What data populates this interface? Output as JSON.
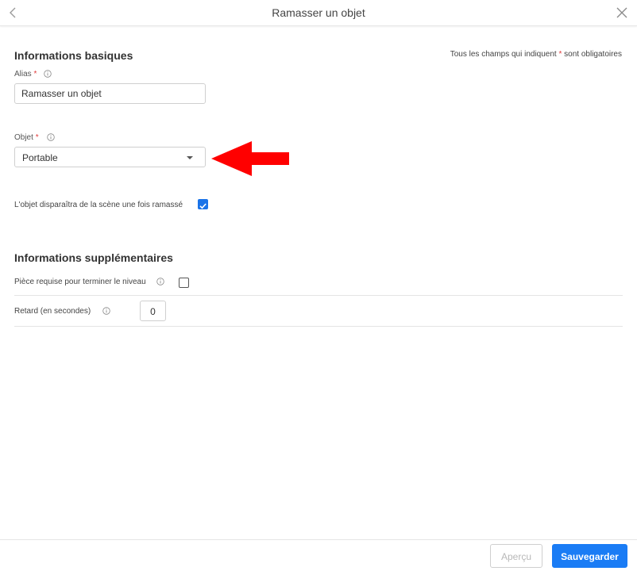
{
  "header": {
    "title": "Ramasser un objet"
  },
  "basic": {
    "section_title": "Informations basiques",
    "required_note_prefix": "Tous les champs qui indiquent ",
    "required_star": "*",
    "required_note_suffix": " sont obligatoires",
    "alias_label": "Alias",
    "alias_value": "Ramasser un objet",
    "object_label": "Objet",
    "object_value": "Portable",
    "disappear_label": "L'objet disparaîtra de la scène une fois ramassé",
    "disappear_checked": true
  },
  "extra": {
    "section_title": "Informations supplémentaires",
    "required_piece_label": "Pièce requise pour terminer le niveau",
    "required_piece_checked": false,
    "delay_label": "Retard (en secondes)",
    "delay_value": "0"
  },
  "footer": {
    "preview_label": "Aperçu",
    "save_label": "Sauvegarder"
  },
  "colors": {
    "accent": "#1a7cf5",
    "arrow": "#ff0000",
    "required": "#e03b3b"
  }
}
